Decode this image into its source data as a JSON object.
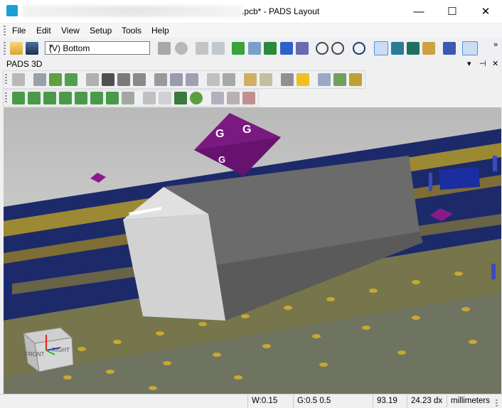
{
  "window": {
    "title": ".pcb* - PADS Layout",
    "controls": {
      "minimize": "—",
      "maximize": "☐",
      "close": "✕"
    }
  },
  "menu": [
    {
      "label": "File"
    },
    {
      "label": "Edit"
    },
    {
      "label": "View"
    },
    {
      "label": "Setup"
    },
    {
      "label": "Tools"
    },
    {
      "label": "Help"
    }
  ],
  "toolbar": {
    "layer_select": "(V) Bottom",
    "overflow": "»"
  },
  "panel": {
    "title": "PADS 3D",
    "controls": {
      "dropdown": "▾",
      "pin": "⊣",
      "close": "✕"
    }
  },
  "viewcube": {
    "front_label": "FRONT",
    "right_label": "RIGHT"
  },
  "status": {
    "width": "W:0.15",
    "grid": "G:0.5 0.5",
    "x": "93.19",
    "y": "24.23 dx",
    "units": "millimeters"
  }
}
